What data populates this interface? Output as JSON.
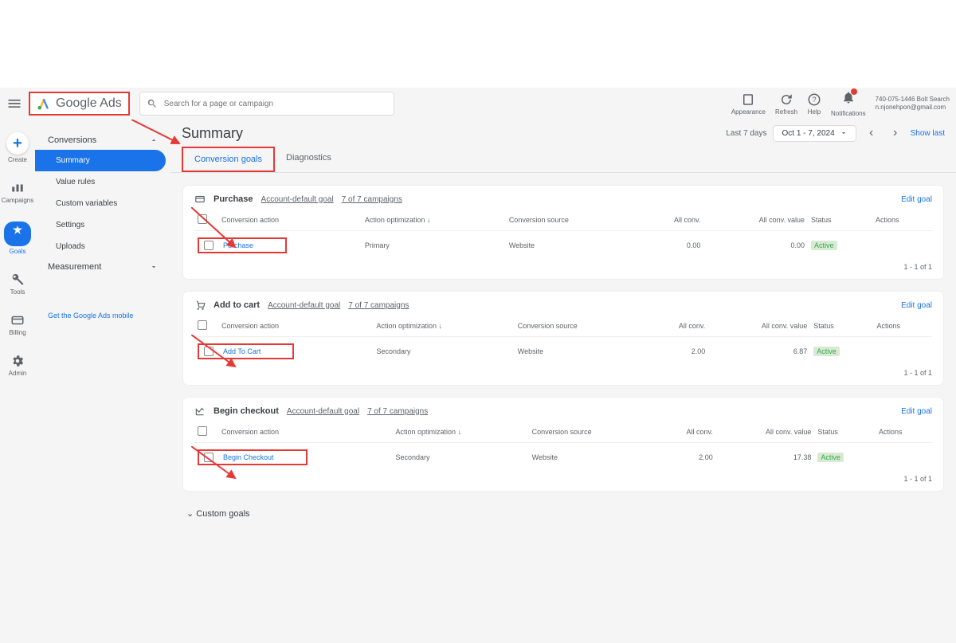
{
  "brand": "Google Ads",
  "search_placeholder": "Search for a page or campaign",
  "header_icons": {
    "appearance": "Appearance",
    "refresh": "Refresh",
    "help": "Help",
    "notifications": "Notifications"
  },
  "account": {
    "id": "740-075-1446 Bolt Search",
    "email": "n.njonehpon@gmail.com"
  },
  "rail": {
    "create": "Create",
    "campaigns": "Campaigns",
    "goals": "Goals",
    "tools": "Tools",
    "billing": "Billing",
    "admin": "Admin"
  },
  "sidebar": {
    "conversions": "Conversions",
    "items": [
      "Summary",
      "Value rules",
      "Custom variables",
      "Settings",
      "Uploads"
    ],
    "measurement": "Measurement",
    "mobile_link": "Get the Google Ads mobile"
  },
  "page": {
    "title": "Summary",
    "last7": "Last 7 days",
    "date_range": "Oct 1 - 7, 2024",
    "show_last": "Show last"
  },
  "tabs": {
    "goals": "Conversion goals",
    "diagnostics": "Diagnostics"
  },
  "table_headers": {
    "action": "Conversion action",
    "optimization": "Action optimization",
    "source": "Conversion source",
    "all_conv": "All conv.",
    "all_conv_value": "All conv. value",
    "status": "Status",
    "actions": "Actions"
  },
  "meta": {
    "default_goal": "Account-default goal",
    "campaign_count": "7 of 7 campaigns",
    "edit": "Edit goal"
  },
  "goals": [
    {
      "title": "Purchase",
      "rows": [
        {
          "action": "Purchase",
          "optimization": "Primary",
          "source": "Website",
          "all_conv": "0.00",
          "value": "0.00",
          "status": "Active"
        }
      ],
      "pagination": "1 - 1 of 1"
    },
    {
      "title": "Add to cart",
      "rows": [
        {
          "action": "Add To Cart",
          "optimization": "Secondary",
          "source": "Website",
          "all_conv": "2.00",
          "value": "6.87",
          "status": "Active"
        }
      ],
      "pagination": "1 - 1 of 1"
    },
    {
      "title": "Begin checkout",
      "rows": [
        {
          "action": "Begin Checkout",
          "optimization": "Secondary",
          "source": "Website",
          "all_conv": "2.00",
          "value": "17.38",
          "status": "Active"
        }
      ],
      "pagination": "1 - 1 of 1"
    }
  ],
  "custom_goals": "Custom goals"
}
